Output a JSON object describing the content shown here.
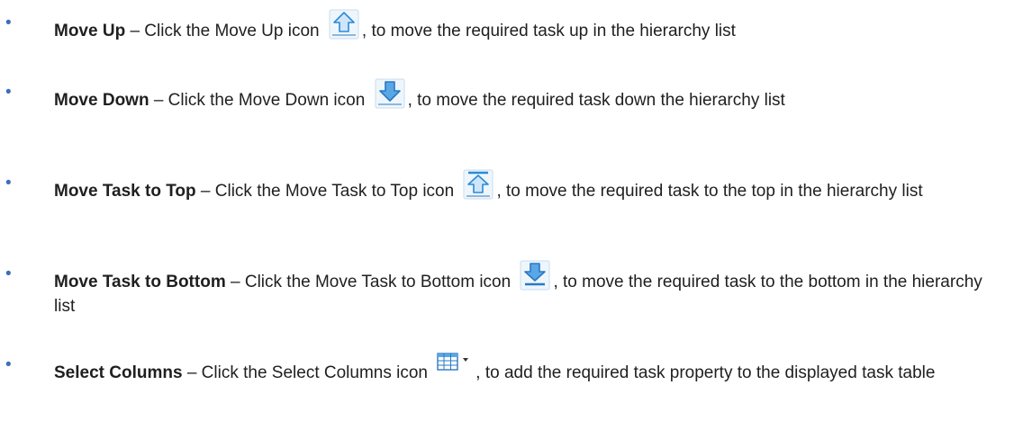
{
  "items": [
    {
      "term": "Move Up",
      "lead": " – Click the Move Up icon ",
      "tail": ", to move the required task up in the hierarchy list",
      "icon": "arrow-up-icon"
    },
    {
      "term": "Move Down",
      "lead": " – Click the Move Down icon ",
      "tail": ", to move the required task down the hierarchy list",
      "icon": "arrow-down-icon"
    },
    {
      "term": "Move Task to Top",
      "lead": " – Click the Move Task to Top icon ",
      "tail": ", to move the required task to the top in the hierarchy list",
      "icon": "arrow-to-top-icon"
    },
    {
      "term": "Move Task to Bottom",
      "lead": " – Click the Move Task to Bottom icon ",
      "tail": ", to move the required task to the bottom in the hierarchy list",
      "icon": "arrow-to-bottom-icon"
    },
    {
      "term": "Select Columns",
      "lead": " – Click the Select Columns icon ",
      "tail": ", to add the required task property to the displayed task table",
      "icon": "table-columns-icon"
    }
  ],
  "colors": {
    "bullet": "#3d6fb6",
    "icon_blue": "#2a8ad6",
    "icon_light": "#cfe6fa",
    "text": "#1f1f1f"
  }
}
